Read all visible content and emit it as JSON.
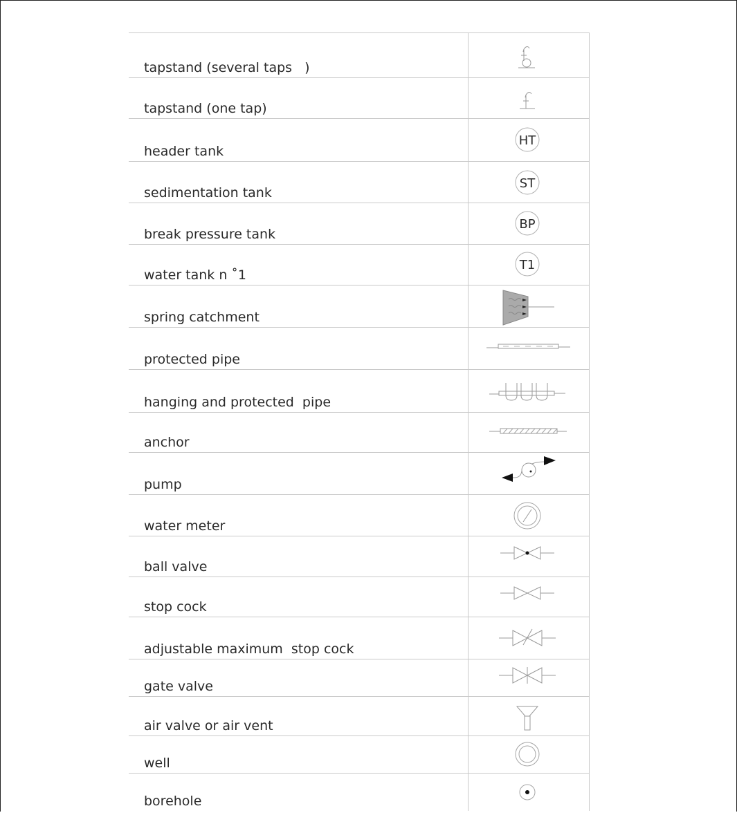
{
  "rows": [
    {
      "label": "tapstand (several taps   )",
      "icon": "tapstand-several-taps-icon"
    },
    {
      "label": "tapstand (one tap)",
      "icon": "tapstand-one-tap-icon"
    },
    {
      "label": "header tank",
      "icon": "header-tank-icon",
      "code": "HT"
    },
    {
      "label": "sedimentation tank",
      "icon": "sedimentation-tank-icon",
      "code": "ST"
    },
    {
      "label": "break pressure tank",
      "icon": "break-pressure-tank-icon",
      "code": "BP"
    },
    {
      "label": "water tank n ˚1",
      "icon": "water-tank-icon",
      "code": "T1"
    },
    {
      "label": "spring catchment",
      "icon": "spring-catchment-icon"
    },
    {
      "label": "protected pipe",
      "icon": "protected-pipe-icon"
    },
    {
      "label": "hanging and protected  pipe",
      "icon": "hanging-protected-pipe-icon"
    },
    {
      "label": "anchor",
      "icon": "anchor-icon"
    },
    {
      "label": "pump",
      "icon": "pump-icon"
    },
    {
      "label": "water meter",
      "icon": "water-meter-icon"
    },
    {
      "label": "ball valve",
      "icon": "ball-valve-icon"
    },
    {
      "label": "stop cock",
      "icon": "stop-cock-icon"
    },
    {
      "label": "adjustable maximum  stop cock",
      "icon": "adjustable-stop-cock-icon"
    },
    {
      "label": "gate valve",
      "icon": "gate-valve-icon"
    },
    {
      "label": "air valve or air vent",
      "icon": "air-valve-icon"
    },
    {
      "label": "well",
      "icon": "well-icon"
    },
    {
      "label": "borehole",
      "icon": "borehole-icon"
    }
  ],
  "colors": {
    "text": "#2a2a2a",
    "grid": "#c8c8c8",
    "symbol_stroke": "#9a9a9a",
    "symbol_fill": "#aaaaaa",
    "arrow": "#111111"
  }
}
